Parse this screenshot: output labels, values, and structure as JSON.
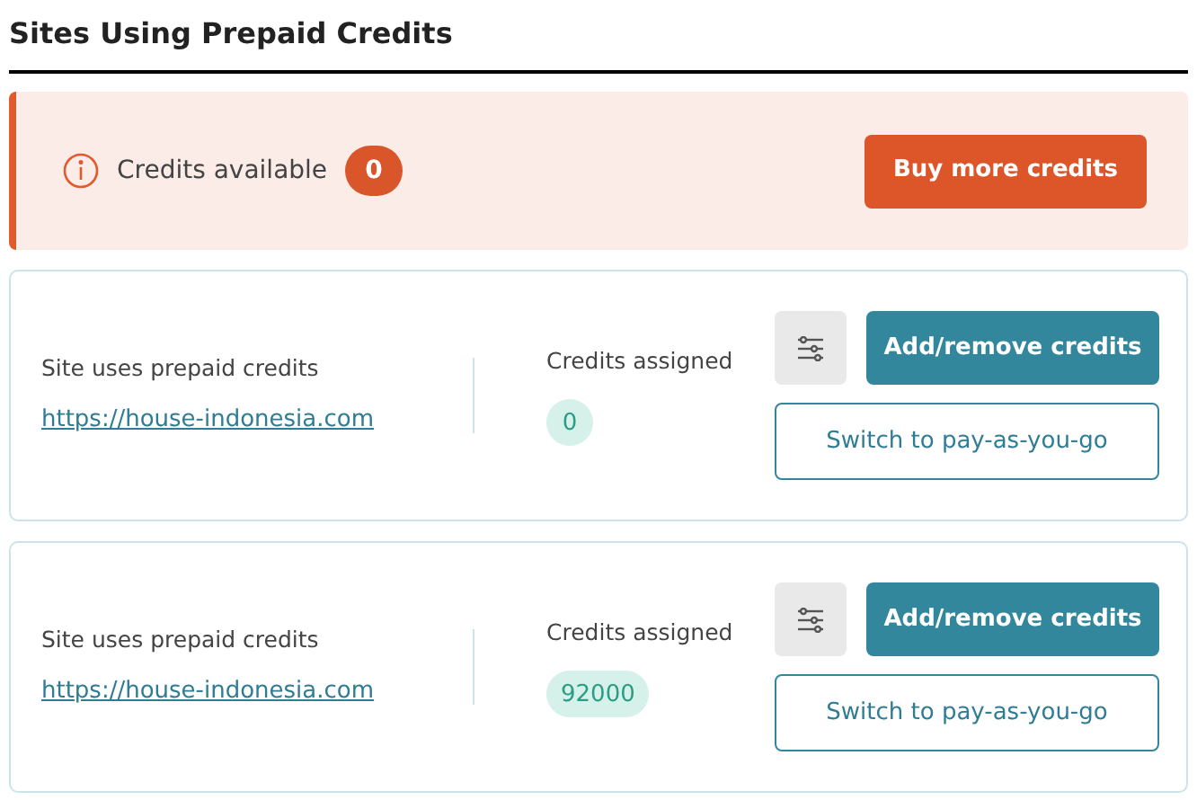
{
  "title": "Sites Using Prepaid Credits",
  "alert": {
    "label": "Credits available",
    "count": "0",
    "button": "Buy more credits"
  },
  "sites": [
    {
      "status": "Site uses prepaid credits",
      "url": "https://house-indonesia.com",
      "assigned_label": "Credits assigned",
      "assigned": "0",
      "primary_button": "Add/remove credits",
      "secondary_button": "Switch to pay-as-you-go"
    },
    {
      "status": "Site uses prepaid credits",
      "url": "https://house-indonesia.com",
      "assigned_label": "Credits assigned",
      "assigned": "92000",
      "primary_button": "Add/remove credits",
      "secondary_button": "Switch to pay-as-you-go"
    }
  ]
}
